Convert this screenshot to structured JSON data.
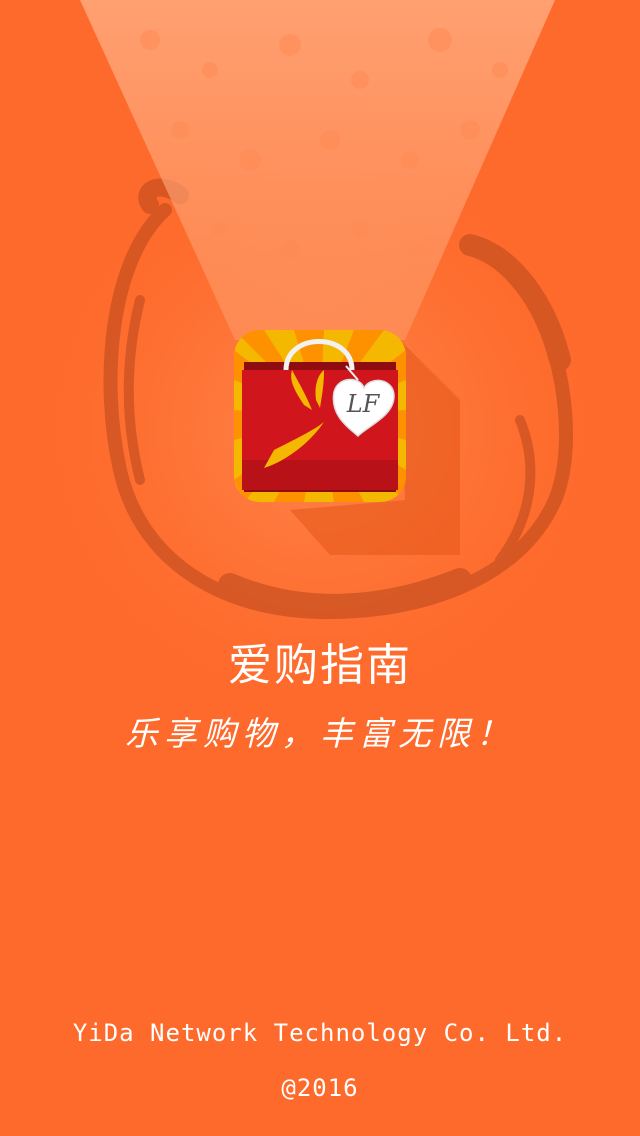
{
  "app": {
    "title": "爱购指南",
    "slogan": "乐享购物，丰富无限！",
    "icon_monogram": "LF",
    "icon": "shopping-bag-icon"
  },
  "footer": {
    "company": "YiDa Network Technology Co. Ltd.",
    "copyright": "@2016"
  },
  "colors": {
    "background": "#fe6a2b",
    "bag_red": "#d0161c",
    "icon_frame_yellow": "#f5b800",
    "text": "#ffffff"
  }
}
